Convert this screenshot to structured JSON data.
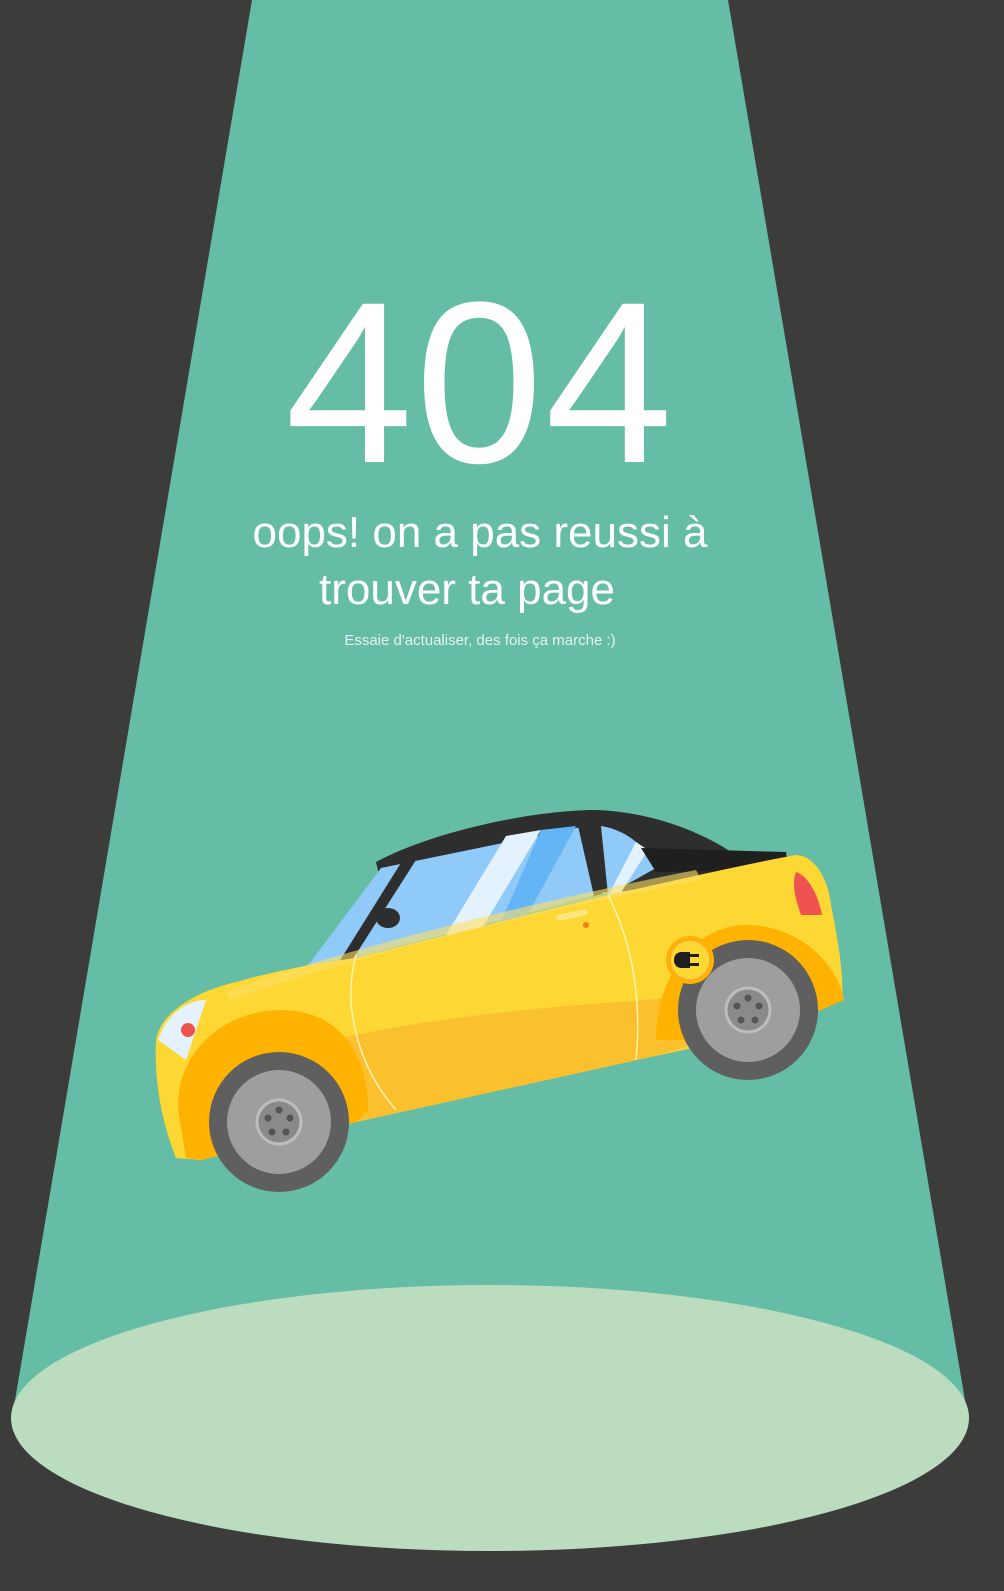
{
  "error": {
    "code": "404",
    "headline_line1": "oops! on a pas reussi à",
    "headline_line2": "trouver ta page",
    "hint": "Essaie d'actualiser, des fois ça marche :)"
  },
  "colors": {
    "background": "#3c3c3b",
    "spotlight": "#64bda4",
    "floor_spot": "#bcdcc0",
    "car_body": "#fdd835",
    "text": "#ffffff"
  },
  "illustration": {
    "subject": "yellow-electric-car-icon",
    "plug": "plug-icon"
  }
}
